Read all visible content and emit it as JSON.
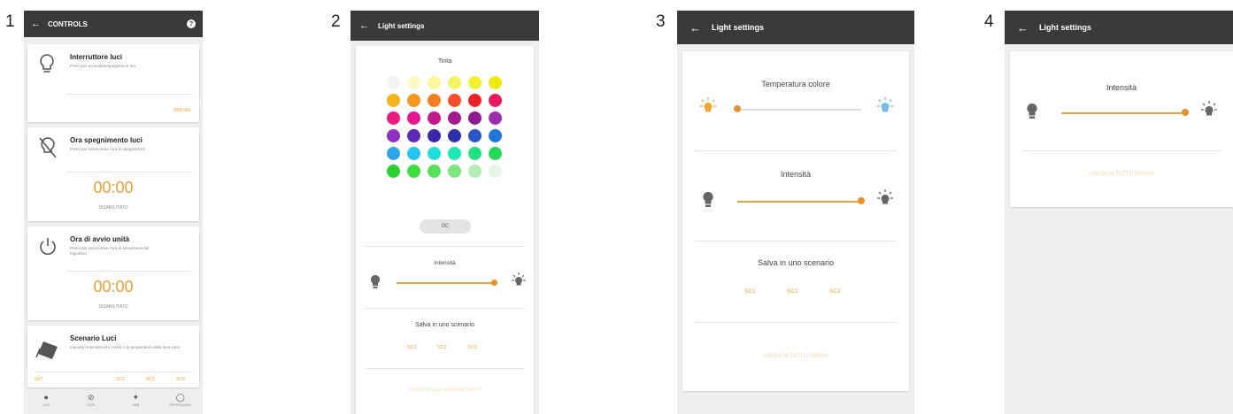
{
  "labels": [
    "1",
    "2",
    "3",
    "4"
  ],
  "colors": {
    "accent": "#f0a030",
    "appbar": "#3a3a3a",
    "background": "#eeeeee"
  },
  "screen1": {
    "title": "CONTROLS",
    "help_icon": "help-icon",
    "cards": [
      {
        "title": "Interruttore luci",
        "desc": "Premi per accendere/spegnere le luci",
        "action": "SPEGNI",
        "icon": "lightbulb-icon"
      },
      {
        "title": "Ora spegnimento luci",
        "desc": "Premi per selezionare l'ora di spegnimento",
        "time": "00:00",
        "status": "DISABILITATO",
        "icon": "lightbulb-off-icon"
      },
      {
        "title": "Ora di avvio unità",
        "desc": "Premi per selezionare l'ora di accensione del frigorifero",
        "time": "00:00",
        "status": "DISABILITATO",
        "icon": "power-icon"
      },
      {
        "title": "Scenario Luci",
        "desc": "Imposta l'intensità ed il colore o la temperatura delle luce vano.",
        "scenes": [
          "SET",
          "SC1",
          "SC2",
          "SC3"
        ],
        "icon": "scene-icon"
      }
    ],
    "bottom_nav": [
      {
        "label": "LUCI",
        "icon": "bulb-nav-icon"
      },
      {
        "label": "LOCK",
        "icon": "lock-nav-icon"
      },
      {
        "label": "HMB",
        "icon": "hmb-nav-icon"
      },
      {
        "label": "IMPOSTAZIONI",
        "icon": "settings-nav-icon"
      }
    ]
  },
  "screen2": {
    "title": "Light settings",
    "tint_label": "Tinta",
    "swatches": [
      "#f4f4f4",
      "#fbf9c6",
      "#fbf69a",
      "#f8f363",
      "#f4ef2f",
      "#f2ea0c",
      "#f7b41a",
      "#f79621",
      "#f57f20",
      "#f2512a",
      "#ec2127",
      "#e7195c",
      "#ef1a7f",
      "#e6178c",
      "#c4178d",
      "#a3198f",
      "#8c1c8b",
      "#9b2fae",
      "#8e2fbf",
      "#5c2ab5",
      "#3b27a8",
      "#2d30a8",
      "#2d55c7",
      "#2077d4",
      "#2aa5e7",
      "#21c4f0",
      "#1fdfde",
      "#1ee6b2",
      "#1fe283",
      "#25d957",
      "#2bd12e",
      "#3ddd3c",
      "#58e05a",
      "#7fe57f",
      "#b2eeb1",
      "#e6f6e5"
    ],
    "off_label": "OC",
    "intensity_label": "Intensità",
    "save_label": "Salva in uno scenario",
    "scenes": [
      "SC1",
      "SC2",
      "SC3"
    ],
    "apply_label": "CHIUDI SULLO / RESTORE STATO"
  },
  "screen3": {
    "title": "Light settings",
    "temp_label": "Temperatura colore",
    "intensity_label": "Intensità",
    "save_label": "Salva in uno scenario",
    "scenes": [
      "SC1",
      "SC2",
      "SC3"
    ],
    "apply_label": "CHIUDI IN TUTTI I RIPIANI",
    "temp_value": 0,
    "intensity_value": 100
  },
  "screen4": {
    "title": "Light settings",
    "intensity_label": "Intensità",
    "apply_label": "CHIUDI IN TUTTI I RIPIANI",
    "intensity_value": 100
  }
}
